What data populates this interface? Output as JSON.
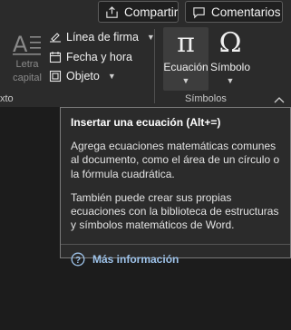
{
  "header": {
    "share_label": "Compartir",
    "comments_label": "Comentarios"
  },
  "ribbon": {
    "drop_cap": {
      "label_line1": "Letra",
      "label_line2": "capital",
      "icon": "drop-cap-icon"
    },
    "text_group": {
      "items": [
        {
          "label": "Línea de firma",
          "icon": "signature-line-icon",
          "has_dropdown": true
        },
        {
          "label": "Fecha y hora",
          "icon": "calendar-icon",
          "has_dropdown": false
        },
        {
          "label": "Objeto",
          "icon": "object-icon",
          "has_dropdown": true
        }
      ],
      "group_label": "xto"
    },
    "symbols_group": {
      "equation": {
        "symbol": "π",
        "label": "Ecuación",
        "icon": "pi-icon"
      },
      "symbol": {
        "symbol": "Ω",
        "label": "Símbolo",
        "icon": "omega-icon"
      },
      "group_label": "Símbolos"
    }
  },
  "tooltip": {
    "title": "Insertar una ecuación (Alt+=)",
    "paragraph1": "Agrega ecuaciones matemáticas comunes al documento, como el área de un círculo o la fórmula cuadrática.",
    "paragraph2": "También puede crear sus propias ecuaciones con la biblioteca de estructuras y símbolos matemáticos de Word.",
    "more_info": "Más información"
  },
  "colors": {
    "background": "#1c1c1c",
    "ribbon": "#2b2b2b",
    "link": "#9ec3ea"
  }
}
